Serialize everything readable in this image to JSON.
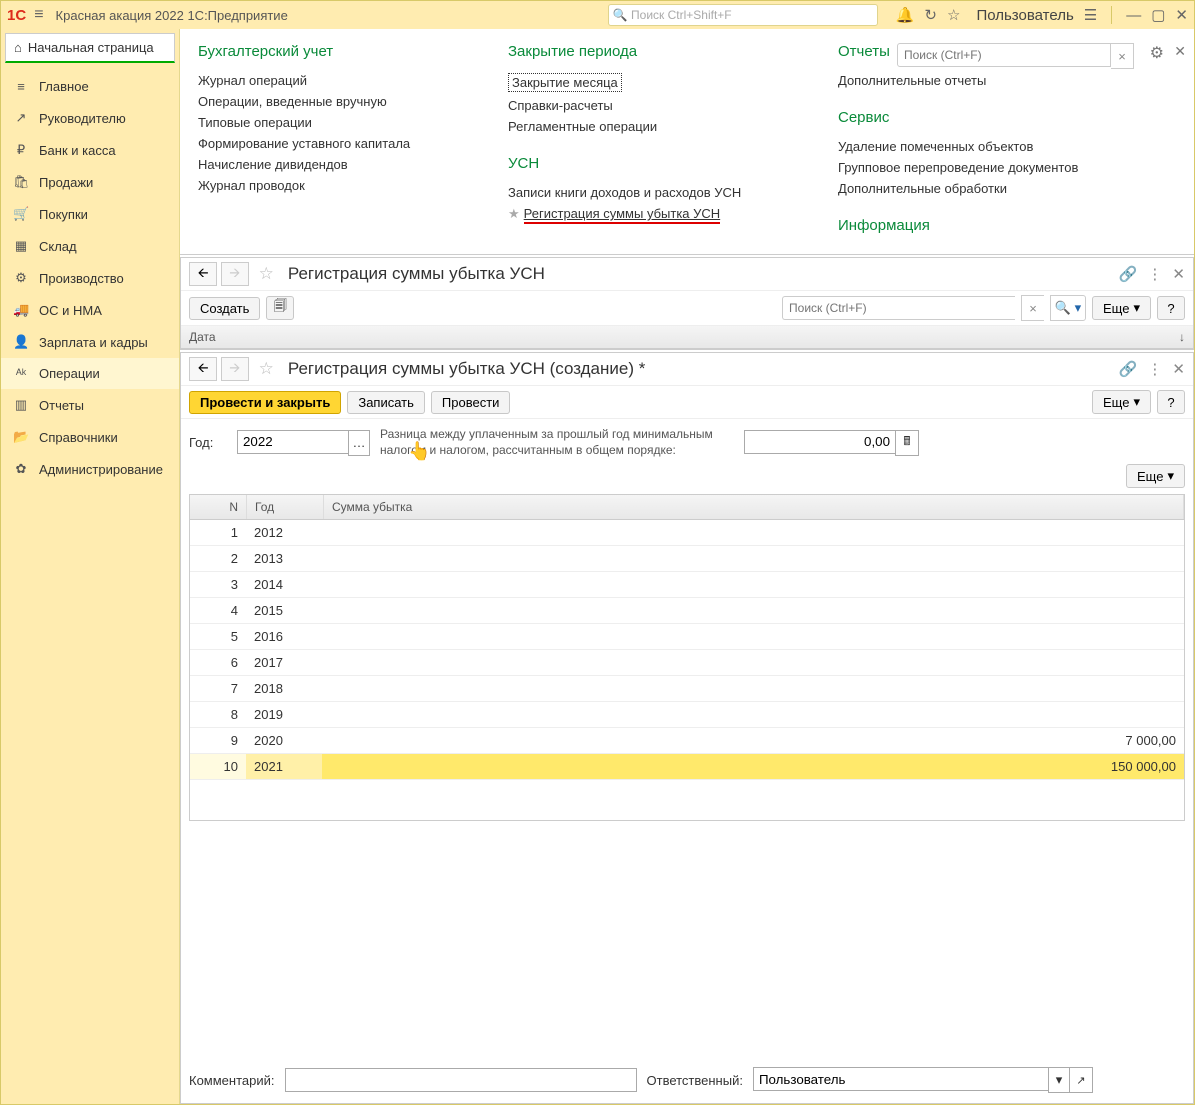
{
  "app": {
    "title": "Красная акация 2022 1С:Предприятие",
    "search_placeholder": "Поиск Ctrl+Shift+F",
    "user": "Пользователь"
  },
  "start_tab": "Начальная страница",
  "nav": [
    {
      "icon": "≡",
      "label": "Главное"
    },
    {
      "icon": "↗",
      "label": "Руководителю"
    },
    {
      "icon": "₽",
      "label": "Банк и касса"
    },
    {
      "icon": "🛍",
      "label": "Продажи"
    },
    {
      "icon": "🛒",
      "label": "Покупки"
    },
    {
      "icon": "▦",
      "label": "Склад"
    },
    {
      "icon": "⚙",
      "label": "Производство"
    },
    {
      "icon": "🚚",
      "label": "ОС и НМА"
    },
    {
      "icon": "👤",
      "label": "Зарплата и кадры"
    },
    {
      "icon": "ᴬᵏ",
      "label": "Операции"
    },
    {
      "icon": "▥",
      "label": "Отчеты"
    },
    {
      "icon": "📂",
      "label": "Справочники"
    },
    {
      "icon": "✿",
      "label": "Администрирование"
    }
  ],
  "functions": {
    "search_placeholder": "Поиск (Ctrl+F)",
    "col1": {
      "title": "Бухгалтерский учет",
      "links": [
        "Журнал операций",
        "Операции, введенные вручную",
        "Типовые операции",
        "Формирование уставного капитала",
        "Начисление дивидендов",
        "Журнал проводок"
      ]
    },
    "col2a": {
      "title": "Закрытие периода",
      "links": [
        "Закрытие месяца",
        "Справки-расчеты",
        "Регламентные операции"
      ]
    },
    "col2b": {
      "title": "УСН",
      "links": [
        "Записи книги доходов и расходов УСН",
        "Регистрация суммы убытка УСН"
      ]
    },
    "col3a": {
      "title": "Отчеты",
      "links": [
        "Дополнительные отчеты"
      ]
    },
    "col3b": {
      "title": "Сервис",
      "links": [
        "Удаление помеченных объектов",
        "Групповое перепроведение документов",
        "Дополнительные обработки"
      ]
    },
    "col3c": {
      "title": "Информация"
    }
  },
  "pane_list": {
    "title": "Регистрация суммы убытка УСН",
    "create": "Создать",
    "search_placeholder": "Поиск (Ctrl+F)",
    "more": "Еще",
    "date_col": "Дата"
  },
  "pane_form": {
    "title": "Регистрация суммы убытка УСН (создание) *",
    "post_close": "Провести и закрыть",
    "save": "Записать",
    "post": "Провести",
    "more": "Еще",
    "year_label": "Год:",
    "year_value": "2022",
    "diff_label": "Разница между уплаченным за прошлый год минимальным налогом и налогом, рассчитанным в общем порядке:",
    "diff_value": "0,00",
    "grid_more": "Еще",
    "cols": {
      "n": "N",
      "year": "Год",
      "sum": "Сумма убытка"
    },
    "rows": [
      {
        "n": "1",
        "year": "2012",
        "sum": ""
      },
      {
        "n": "2",
        "year": "2013",
        "sum": ""
      },
      {
        "n": "3",
        "year": "2014",
        "sum": ""
      },
      {
        "n": "4",
        "year": "2015",
        "sum": ""
      },
      {
        "n": "5",
        "year": "2016",
        "sum": ""
      },
      {
        "n": "6",
        "year": "2017",
        "sum": ""
      },
      {
        "n": "7",
        "year": "2018",
        "sum": ""
      },
      {
        "n": "8",
        "year": "2019",
        "sum": ""
      },
      {
        "n": "9",
        "year": "2020",
        "sum": "7 000,00"
      },
      {
        "n": "10",
        "year": "2021",
        "sum": "150 000,00"
      }
    ],
    "comment_label": "Комментарий:",
    "resp_label": "Ответственный:",
    "resp_value": "Пользователь"
  }
}
